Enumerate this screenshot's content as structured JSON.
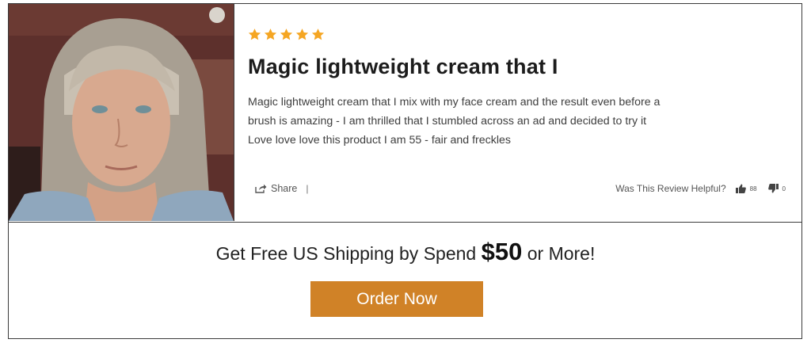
{
  "review": {
    "rating": 5,
    "max_rating": 5,
    "star_color": "#f5a623",
    "title": "Magic lightweight cream that I",
    "body_lines": [
      "Magic lightweight cream that I mix with my face cream and the result even before a",
      "brush is amazing - I am thrilled that I stumbled across an ad and decided to try it",
      "Love love love this product I am 55 - fair and freckles"
    ],
    "share_label": "Share",
    "separator": "|",
    "helpful_label": "Was This Review Helpful?",
    "upvotes": "88",
    "downvotes": "0"
  },
  "promo": {
    "text_before": "Get Free US Shipping by Spend ",
    "price": "$50",
    "text_after": " or More!"
  },
  "cta": {
    "label": "Order Now",
    "color": "#d08227"
  }
}
